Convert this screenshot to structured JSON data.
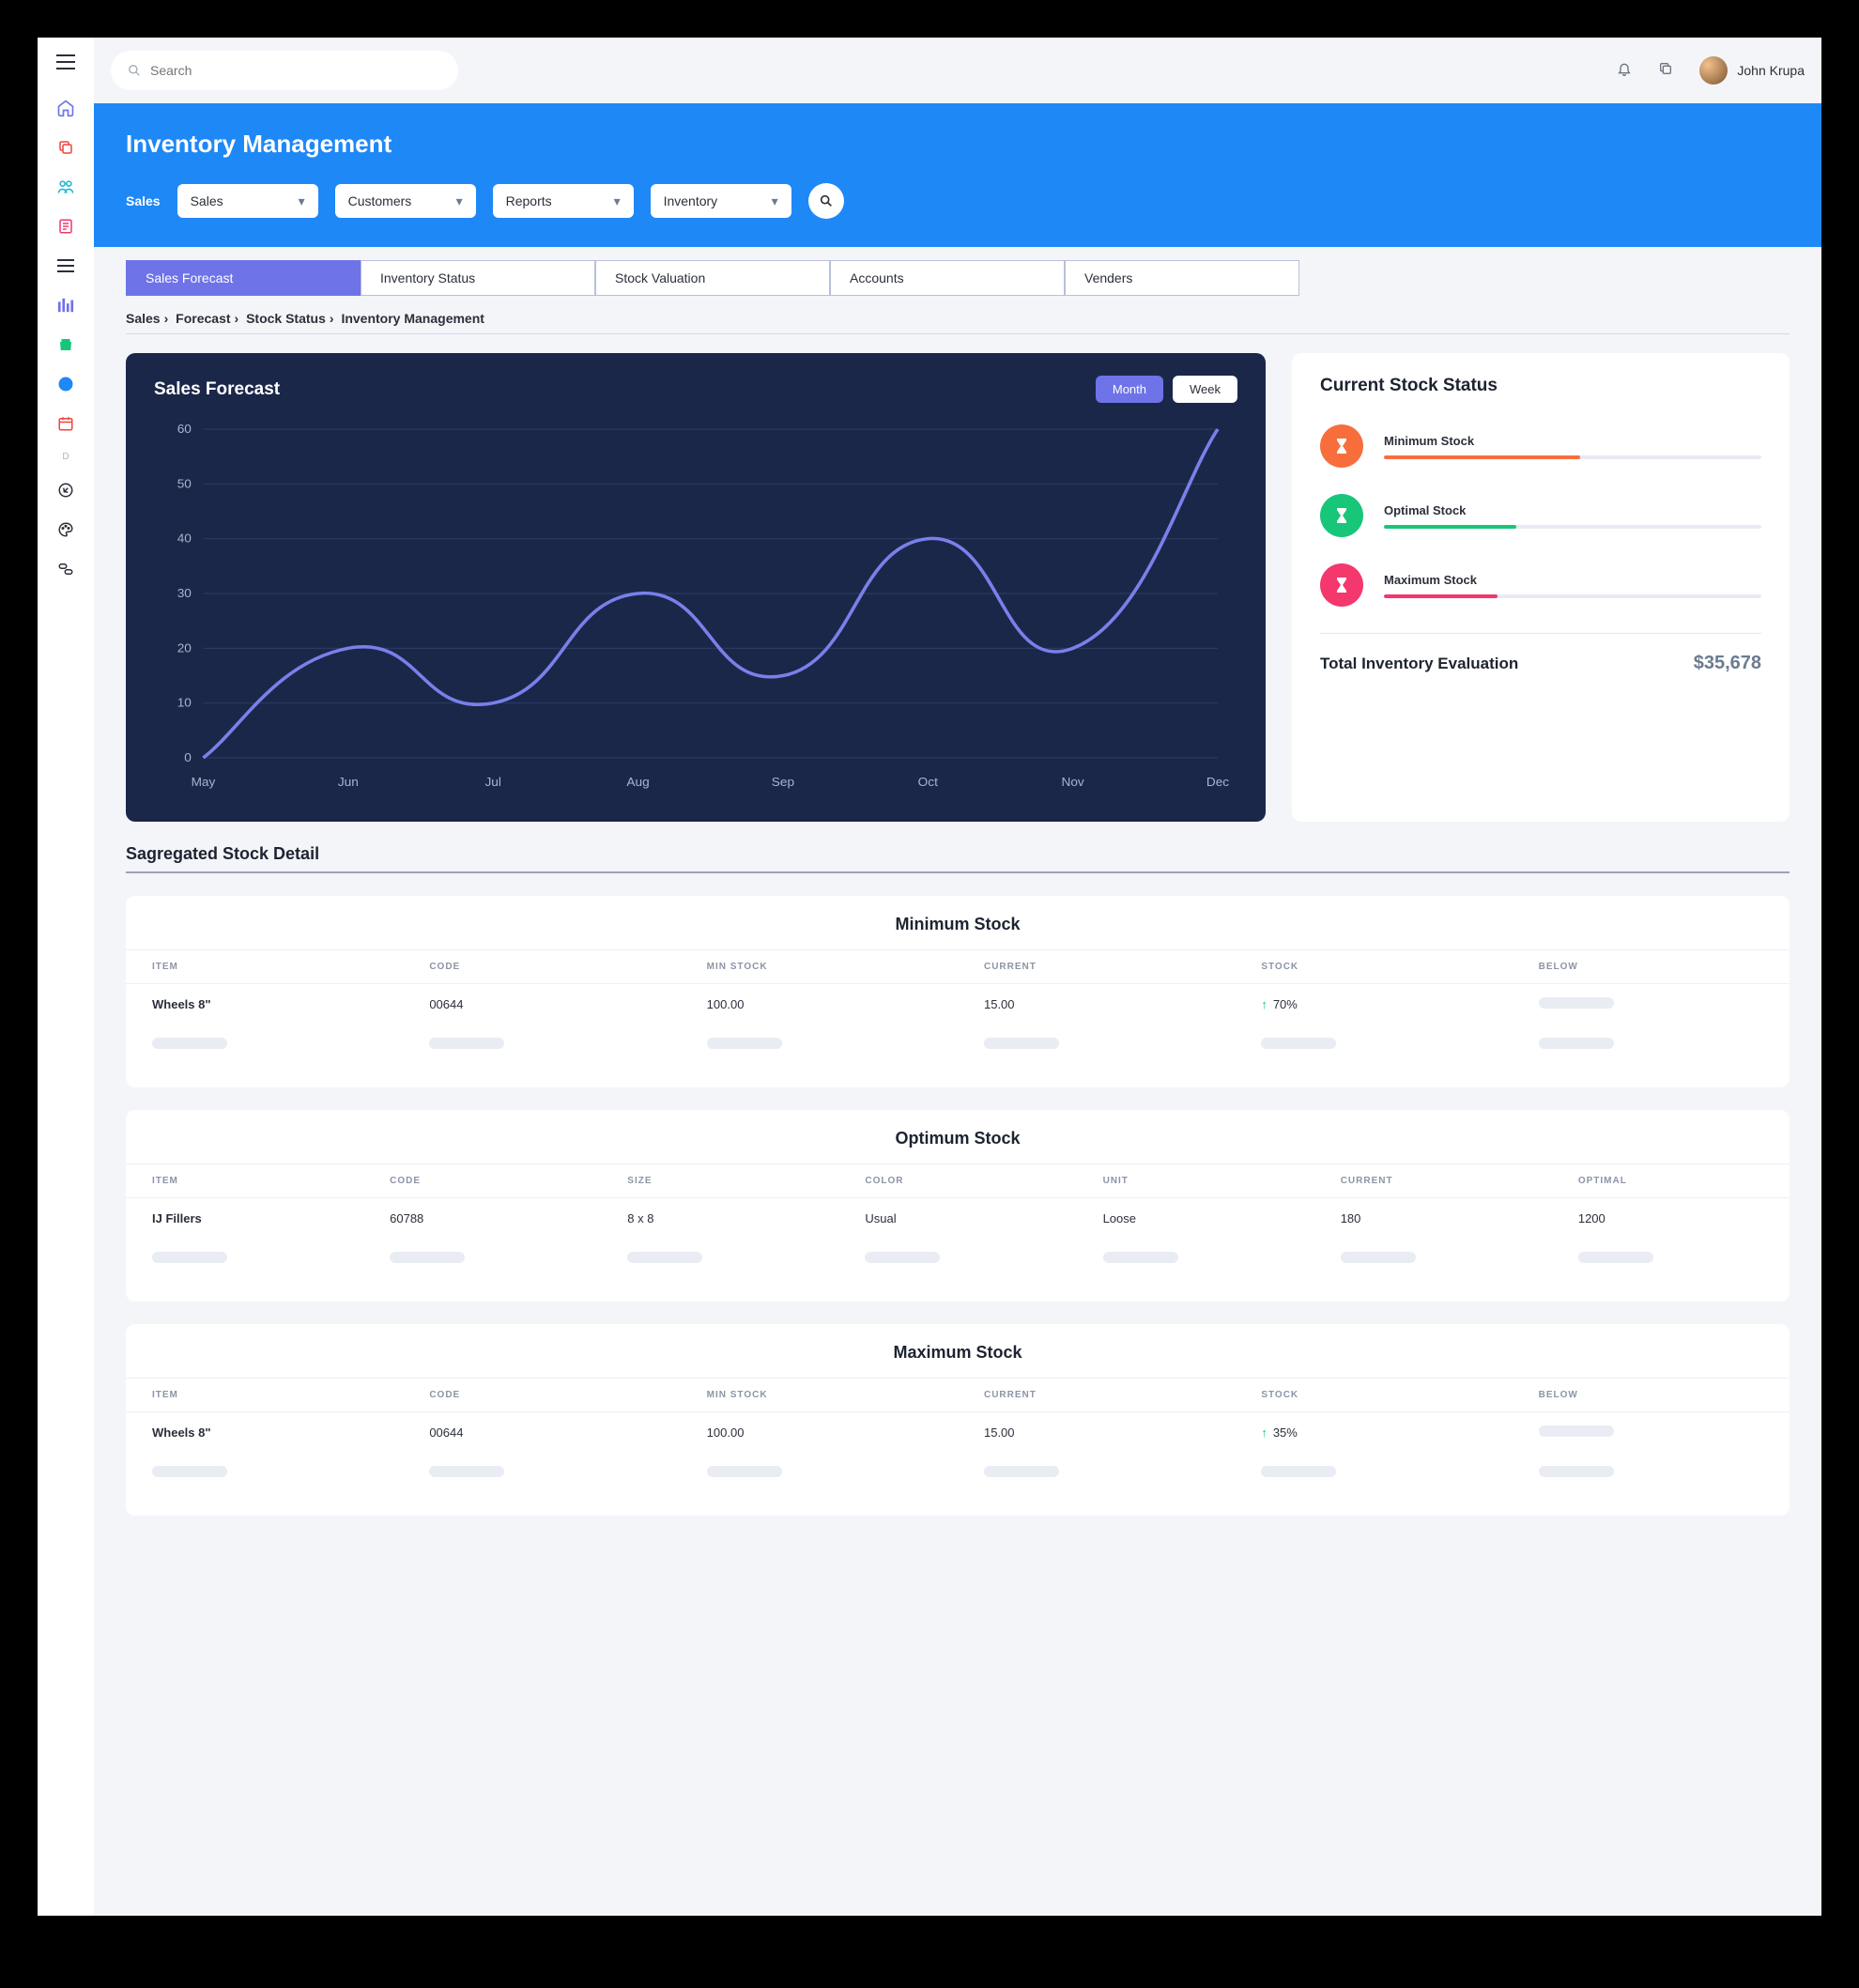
{
  "search": {
    "placeholder": "Search"
  },
  "user": {
    "name": "John Krupa"
  },
  "header": {
    "title": "Inventory Management",
    "filter_label": "Sales",
    "selects": [
      "Sales",
      "Customers",
      "Reports",
      "Inventory"
    ]
  },
  "tabs": [
    "Sales Forecast",
    "Inventory Status",
    "Stock Valuation",
    "Accounts",
    "Venders"
  ],
  "breadcrumb": [
    "Sales",
    "Forecast",
    "Stock Status",
    "Inventory Management"
  ],
  "chart_card": {
    "title": "Sales Forecast",
    "btn_month": "Month",
    "btn_week": "Week"
  },
  "chart_data": {
    "type": "line",
    "title": "Sales Forecast",
    "x": [
      "May",
      "Jun",
      "Jul",
      "Aug",
      "Sep",
      "Oct",
      "Nov",
      "Dec"
    ],
    "y": [
      0,
      20,
      10,
      30,
      15,
      40,
      20,
      60
    ],
    "ylim": [
      0,
      60
    ],
    "yticks": [
      0,
      10,
      20,
      30,
      40,
      50,
      60
    ],
    "xlabel": "",
    "ylabel": ""
  },
  "stock_status": {
    "title": "Current Stock Status",
    "rows": [
      {
        "label": "Minimum Stock",
        "color": "orange",
        "fill_pct": 52
      },
      {
        "label": "Optimal Stock",
        "color": "green",
        "fill_pct": 35
      },
      {
        "label": "Maximum Stock",
        "color": "pink",
        "fill_pct": 30
      }
    ],
    "total_label": "Total Inventory Evaluation",
    "total_value": "$35,678"
  },
  "section_sagregated": "Sagregated Stock Detail",
  "tables": {
    "minimum": {
      "title": "Minimum Stock",
      "headers": [
        "ITEM",
        "CODE",
        "MIN STOCK",
        "CURRENT",
        "STOCK",
        "BELOW"
      ],
      "row": {
        "item": "Wheels 8\"",
        "code": "00644",
        "minstock": "100.00",
        "current": "15.00",
        "stock_pct": "70%"
      }
    },
    "optimum": {
      "title": "Optimum Stock",
      "headers": [
        "ITEM",
        "CODE",
        "SIZE",
        "COLOR",
        "UNIT",
        "CURRENT",
        "OPTIMAL"
      ],
      "row": {
        "item": "IJ Fillers",
        "code": "60788",
        "size": "8 x 8",
        "color": "Usual",
        "unit": "Loose",
        "current": "180",
        "optimal": "1200"
      }
    },
    "maximum": {
      "title": "Maximum Stock",
      "headers": [
        "ITEM",
        "CODE",
        "MIN STOCK",
        "CURRENT",
        "STOCK",
        "BELOW"
      ],
      "row": {
        "item": "Wheels 8\"",
        "code": "00644",
        "minstock": "100.00",
        "current": "15.00",
        "stock_pct": "35%"
      }
    }
  }
}
